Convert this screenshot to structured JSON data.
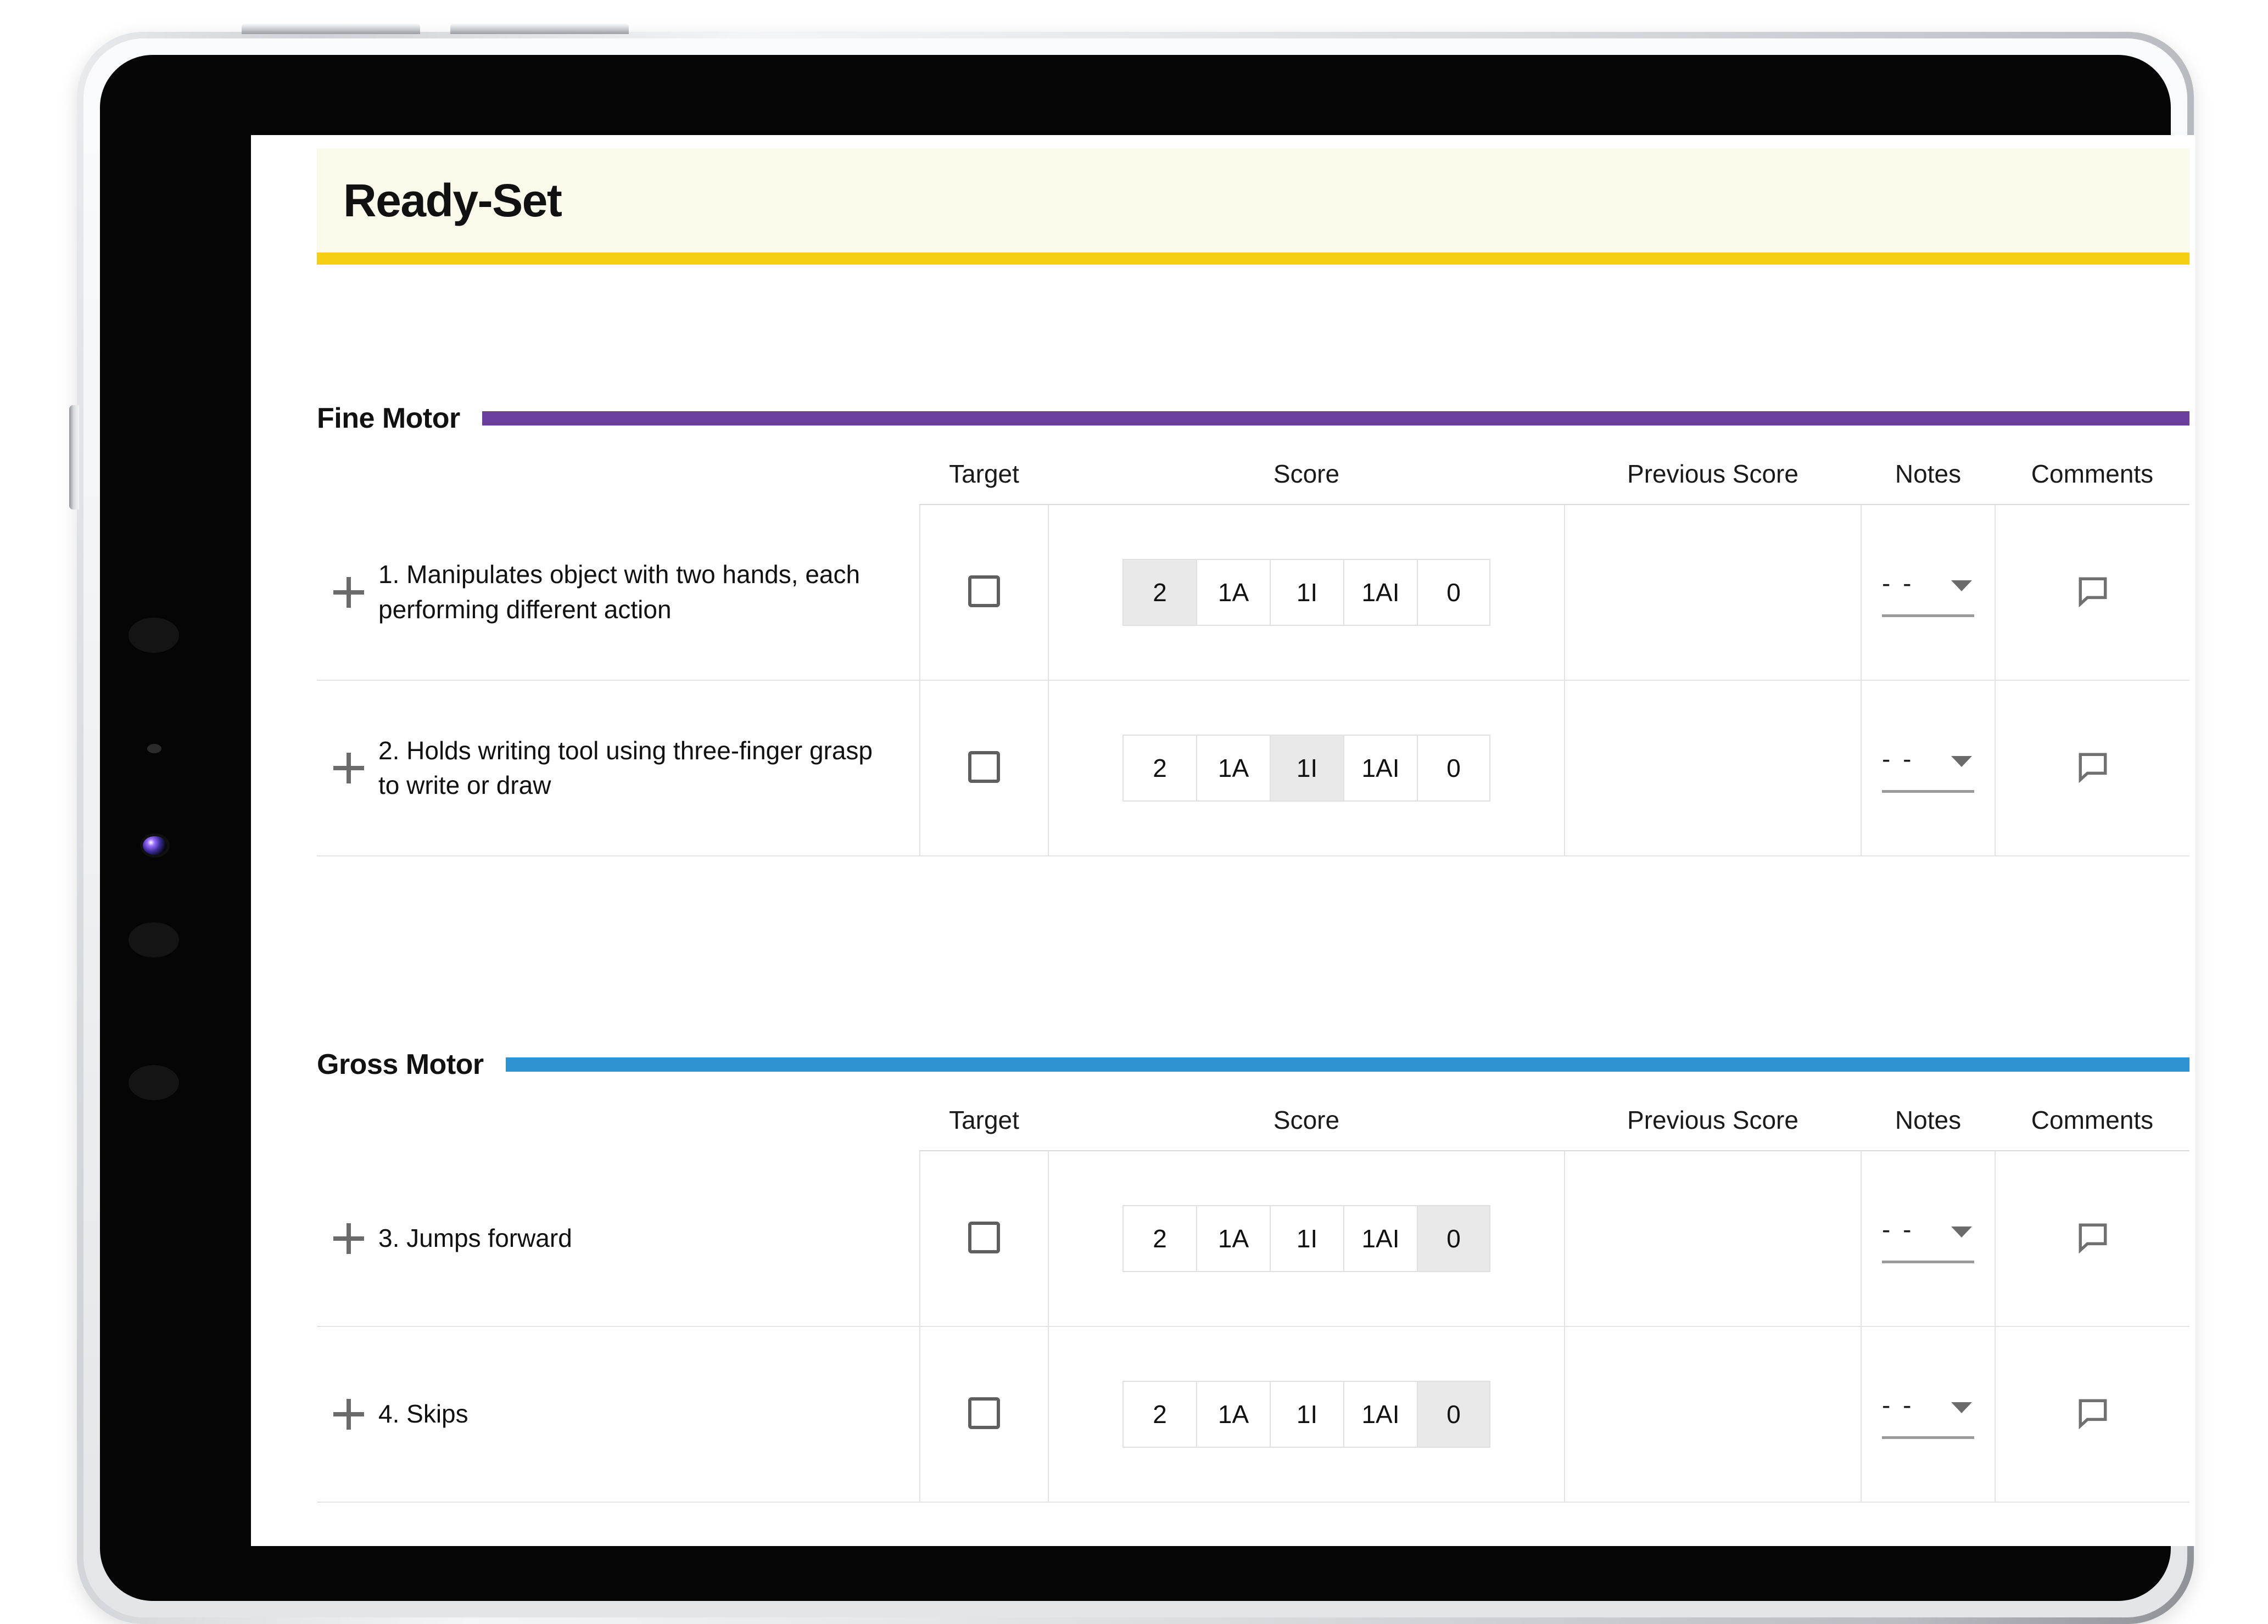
{
  "app": {
    "title": "Ready-Set",
    "banner_bg": "#fcfaeb",
    "banner_bar": "#f6cf14"
  },
  "columns": {
    "item": "",
    "target": "Target",
    "score": "Score",
    "previous_score": "Previous Score",
    "notes": "Notes",
    "comments": "Comments"
  },
  "score_options": [
    "2",
    "1A",
    "1I",
    "1AI",
    "0"
  ],
  "notes_placeholder": "- -",
  "icons": {
    "expand": "plus-icon",
    "caret": "chevron-down-icon",
    "comment": "comment-bubble-icon",
    "checkbox": "checkbox-icon"
  },
  "sections": [
    {
      "title": "Fine Motor",
      "color": "#6a3fa0",
      "rows": [
        {
          "label": "1. Manipulates object with two hands, each performing different action",
          "target_checked": false,
          "selected_score": "2",
          "previous_score": "",
          "notes_value": "- -",
          "has_comment": true
        },
        {
          "label": "2. Holds writing tool using three-finger grasp to write or draw",
          "target_checked": false,
          "selected_score": "1I",
          "previous_score": "",
          "notes_value": "- -",
          "has_comment": true
        }
      ]
    },
    {
      "title": "Gross Motor",
      "color": "#2f93d1",
      "rows": [
        {
          "label": "3. Jumps forward",
          "target_checked": false,
          "selected_score": "0",
          "previous_score": "",
          "notes_value": "- -",
          "has_comment": true
        },
        {
          "label": "4. Skips",
          "target_checked": false,
          "selected_score": "0",
          "previous_score": "",
          "notes_value": "- -",
          "has_comment": true
        }
      ]
    }
  ]
}
